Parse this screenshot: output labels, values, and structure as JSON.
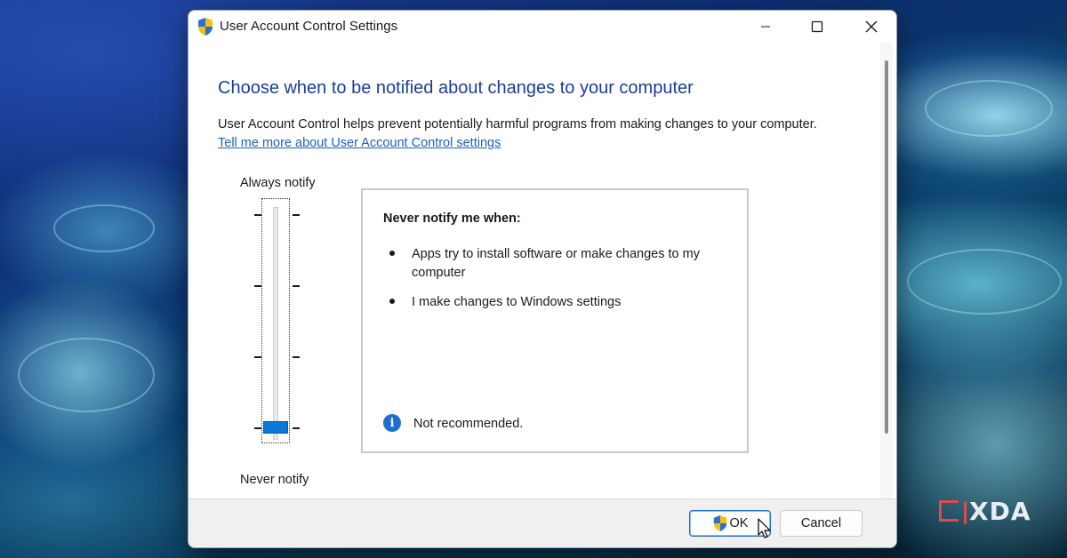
{
  "window": {
    "title": "User Account Control Settings"
  },
  "content": {
    "heading": "Choose when to be notified about changes to your computer",
    "description": "User Account Control helps prevent potentially harmful programs from making changes to your computer.",
    "learn_more_link": "Tell me more about User Account Control settings"
  },
  "slider": {
    "top_label": "Always notify",
    "bottom_label": "Never notify",
    "levels": 4,
    "selected_level": 1
  },
  "panel": {
    "heading": "Never notify me when:",
    "bullets": [
      "Apps try to install software or make changes to my computer",
      "I make changes to Windows settings"
    ],
    "note": "Not recommended."
  },
  "footer": {
    "ok_label": "OK",
    "cancel_label": "Cancel"
  },
  "watermark": {
    "text": "XDA"
  },
  "colors": {
    "heading": "#1a3e96",
    "link": "#1f5fbf",
    "accent": "#0a78d7"
  }
}
